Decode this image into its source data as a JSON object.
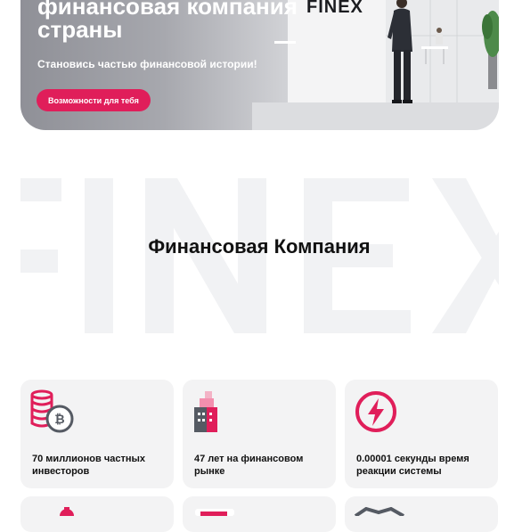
{
  "hero": {
    "title": "финансовая компания страны",
    "subtitle": "Становись частью финансовой истории!",
    "cta_label": "Возможности для тебя",
    "logo_text": "FINEX"
  },
  "brand": {
    "background_word": "FINEX",
    "section_title": "Финансовая Компания"
  },
  "features": [
    {
      "icon": "coins-bitcoin-icon",
      "text": "70 миллионов частных инвесторов"
    },
    {
      "icon": "building-icon",
      "text": "47 лет на финансовом рынке"
    },
    {
      "icon": "lightning-icon",
      "text": "0.00001 секунды время реакции системы"
    }
  ],
  "colors": {
    "accent": "#e01e5a",
    "card_bg": "#f3f3f4",
    "watermark": "#f1f2f4"
  }
}
